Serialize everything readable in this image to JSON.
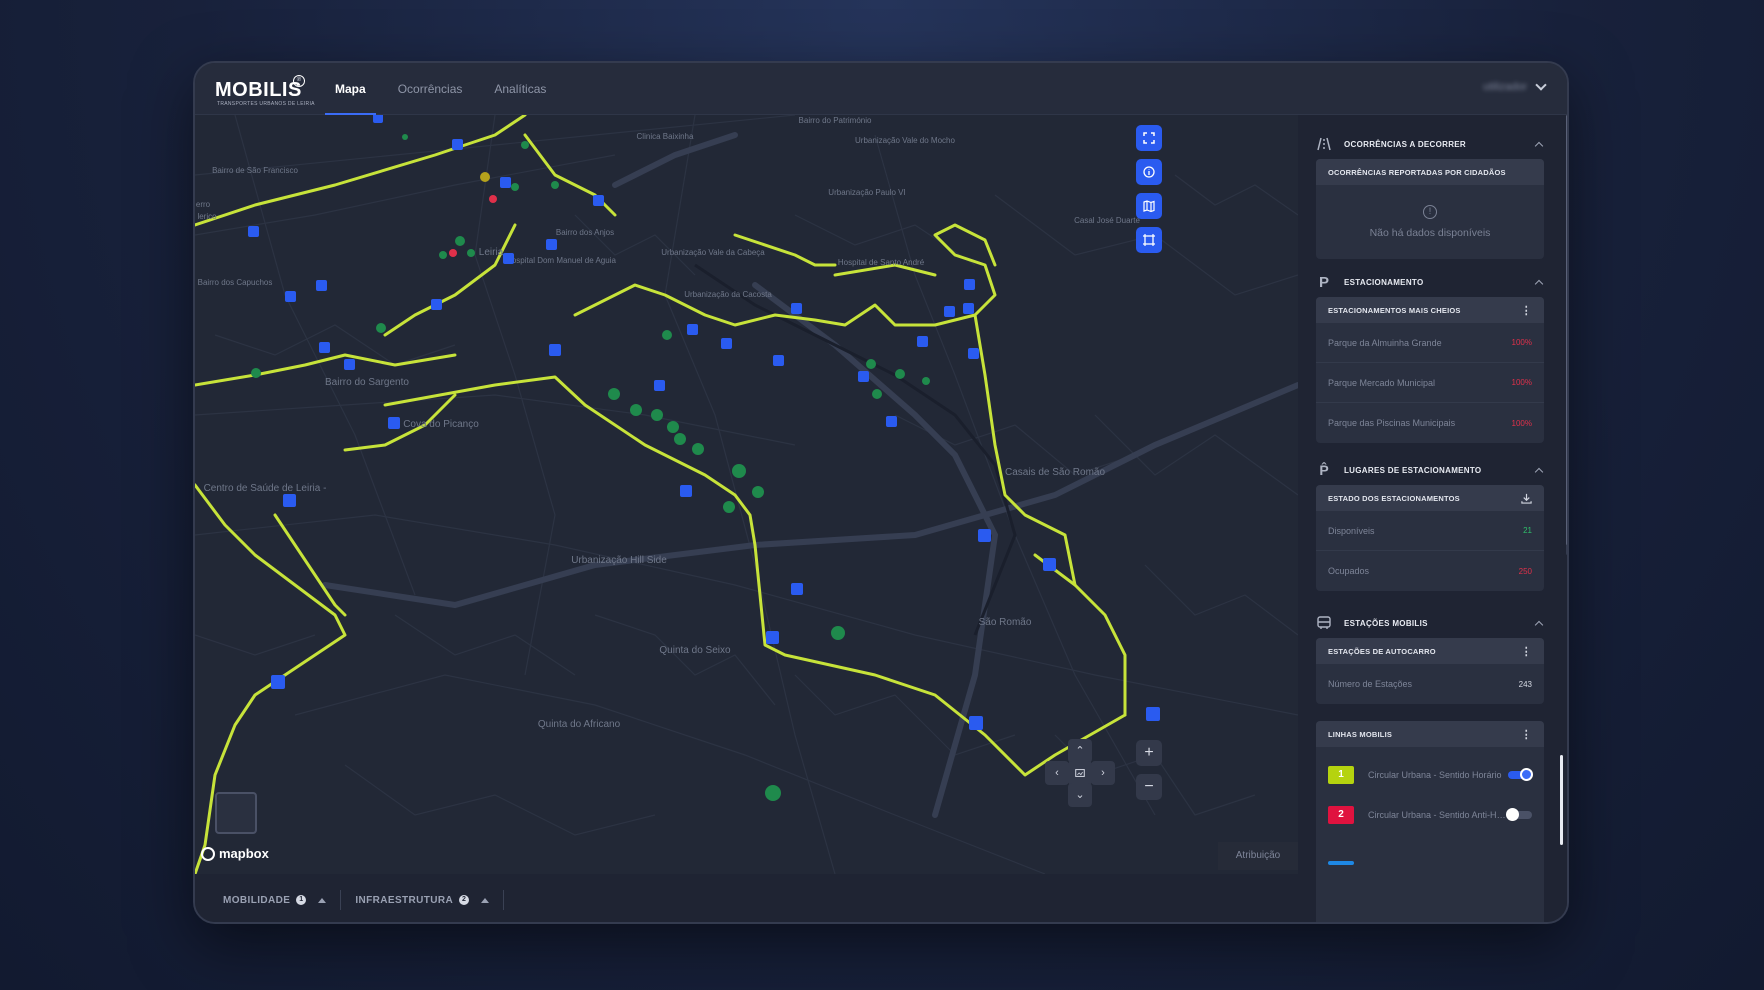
{
  "app": {
    "logo": "MOBILIS",
    "logo_sub": "TRANSPORTES URBANOS DE LEIRIA",
    "logo_badge": "℗"
  },
  "nav": {
    "tabs": [
      "Mapa",
      "Ocorrências",
      "Analíticas"
    ],
    "active": "Mapa"
  },
  "user": {
    "name": "utilizador"
  },
  "map": {
    "places": [
      "Bairro de São Francisco",
      "erro",
      "lerico",
      "Bairro dos Capuchos",
      "Leiria",
      "Hospital Dom Manuel de Aguiar",
      "Bairro dos Anjos",
      "Clinica Baixinha",
      "Urbanização Vale da Cabeça",
      "Urbanização da Cacosta",
      "Hospital de Santo André",
      "Urbanização Vale do Mocho",
      "Urbanização Paulo VI",
      "Bairro do Património",
      "Casal José Duarte",
      "Bairro do Sargento",
      "Cova do Picanço",
      "Centro de Saúde de Leiria - Doutor Gonçalo Henriques",
      "Urbanização Hill Side",
      "Quinta do Seixo",
      "Quinta do Africano",
      "Casais de São Romão",
      "São Romão"
    ],
    "attribution": "Atribuição",
    "brand": "mapbox",
    "zoom_in": "+",
    "zoom_out": "−"
  },
  "bottom": {
    "layers": [
      {
        "label": "MOBILIDADE",
        "count": "1"
      },
      {
        "label": "INFRAESTRUTURA",
        "count": "2"
      }
    ]
  },
  "side": {
    "occurrences": {
      "title": "OCORRÊNCIAS A DECORRER",
      "card_title": "OCORRÊNCIAS REPORTADAS POR CIDADÃOS",
      "empty": "Não há dados disponíveis"
    },
    "parking": {
      "title": "ESTACIONAMENTO",
      "card_title": "ESTACIONAMENTOS MAIS CHEIOS",
      "rows": [
        {
          "name": "Parque da Almuinha Grande",
          "value": "100%"
        },
        {
          "name": "Parque Mercado Municipal",
          "value": "100%"
        },
        {
          "name": "Parque das Piscinas Municipais",
          "value": "100%"
        }
      ]
    },
    "spots": {
      "title": "LUGARES DE ESTACIONAMENTO",
      "card_title": "ESTADO DOS ESTACIONAMENTOS",
      "rows": [
        {
          "name": "Disponíveis",
          "value": "21"
        },
        {
          "name": "Ocupados",
          "value": "250"
        }
      ]
    },
    "stations": {
      "title": "ESTAÇÕES MOBILIS",
      "card_title": "ESTAÇÕES DE AUTOCARRO",
      "rows": [
        {
          "name": "Número de Estações",
          "value": "243"
        }
      ]
    },
    "lines": {
      "card_title": "LINHAS MOBILIS",
      "items": [
        {
          "num": "1",
          "label": "Circular Urbana - Sentido Horário",
          "color": "#b5d30f",
          "enabled": true
        },
        {
          "num": "2",
          "label": "Circular Urbana - Sentido Anti-Horário",
          "color": "#e0123f",
          "enabled": false
        }
      ]
    }
  },
  "colors": {
    "accent": "#2a5bf0",
    "route": "#c7e33a",
    "parking": "#1f8a4c",
    "danger": "#e0304a"
  }
}
